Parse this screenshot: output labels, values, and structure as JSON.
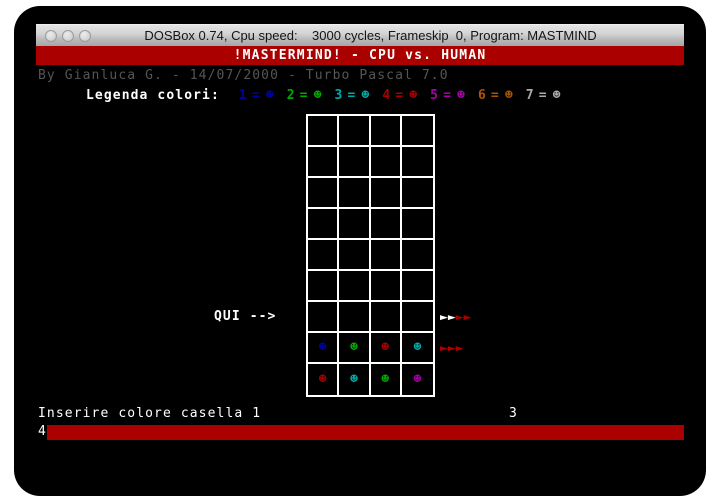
{
  "window": {
    "titlebar_text": "DOSBox 0.74, Cpu speed:    3000 cycles, Frameskip  0, Program: MASTMIND",
    "buttons": [
      "close-button",
      "minimize-button",
      "zoom-button"
    ]
  },
  "screen": {
    "banner": "!MASTERMIND! - CPU vs. HUMAN",
    "author_line": "By Gianluca G. - 14/07/2000 - Turbo Pascal 7.0",
    "banner_color": "#aa0000",
    "background_color": "#000000"
  },
  "legend": {
    "title": "Legenda colori:",
    "face_glyph": "☻",
    "entries": [
      {
        "num": "1",
        "eq": "=",
        "color": "#0000aa",
        "name": "blue"
      },
      {
        "num": "2",
        "eq": "=",
        "color": "#00aa00",
        "name": "green"
      },
      {
        "num": "3",
        "eq": "=",
        "color": "#00aaaa",
        "name": "cyan"
      },
      {
        "num": "4",
        "eq": "=",
        "color": "#aa0000",
        "name": "red"
      },
      {
        "num": "5",
        "eq": "=",
        "color": "#aa00aa",
        "name": "magenta"
      },
      {
        "num": "6",
        "eq": "=",
        "color": "#aa5500",
        "name": "brown"
      },
      {
        "num": "7",
        "eq": "=",
        "color": "#aaaaaa",
        "name": "lightgray"
      }
    ]
  },
  "board": {
    "columns": 4,
    "rows": 9,
    "border_color": "#ffffff",
    "peg_glyph": "☻",
    "guesses": [
      {
        "row": 1,
        "pegs": [
          null,
          null,
          null,
          null
        ]
      },
      {
        "row": 2,
        "pegs": [
          null,
          null,
          null,
          null
        ]
      },
      {
        "row": 3,
        "pegs": [
          null,
          null,
          null,
          null
        ]
      },
      {
        "row": 4,
        "pegs": [
          null,
          null,
          null,
          null
        ]
      },
      {
        "row": 5,
        "pegs": [
          null,
          null,
          null,
          null
        ]
      },
      {
        "row": 6,
        "pegs": [
          null,
          null,
          null,
          null
        ]
      },
      {
        "row": 7,
        "pegs": [
          null,
          null,
          null,
          null
        ]
      },
      {
        "row": 8,
        "pegs": [
          "#0000aa",
          "#00aa00",
          "#aa0000",
          "#00aaaa"
        ]
      },
      {
        "row": 9,
        "pegs": [
          "#aa0000",
          "#00aaaa",
          "#00aa00",
          "#aa00aa"
        ]
      }
    ],
    "feedback": [
      {
        "row": 8,
        "white": 2,
        "red": 2,
        "marker_glyph": "►"
      },
      {
        "row": 9,
        "white": 0,
        "red": 3,
        "marker_glyph": "►"
      }
    ],
    "pointer_label": "QUI -->"
  },
  "prompt": {
    "text": "Inserire colore casella 1",
    "counter": "3",
    "input_value": "4",
    "input_bar_color": "#aa0000"
  }
}
